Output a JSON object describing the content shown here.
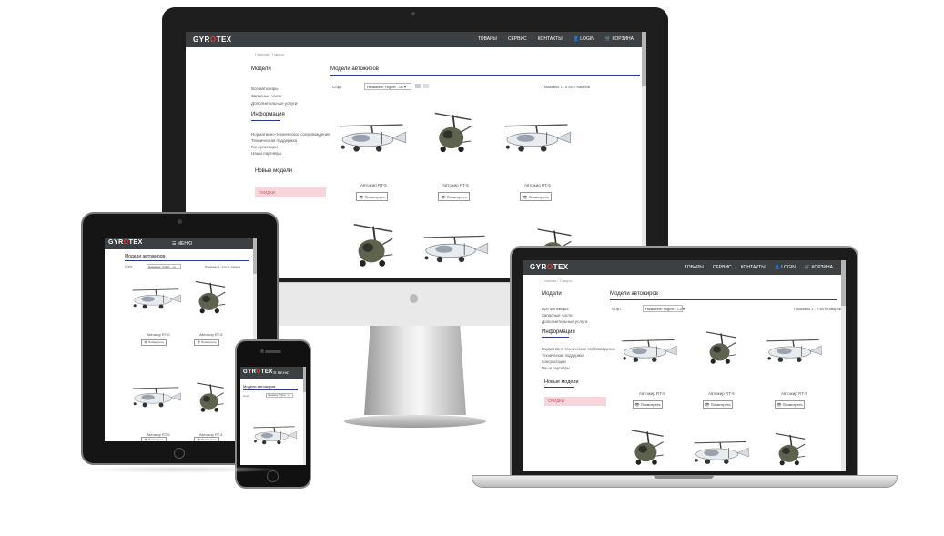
{
  "site": {
    "logo_a": "GYR",
    "logo_o": "O",
    "logo_b": "TEX",
    "nav": [
      "ТОВАРЫ",
      "СЕРВИС",
      "КОНТАКТЫ",
      "LOGIN",
      "КОРЗИНА"
    ],
    "breadcrumb": "Главная / Товары",
    "sidebar": {
      "models_title": "Модели",
      "models_items": [
        "Все автожиры",
        "Запасные части",
        "Дополнительные услуги"
      ],
      "info_title": "Информация",
      "info_items": [
        "Нормативно-техническое сопровождение",
        "Техническая поддержка",
        "Консультации",
        "Наши партнёры"
      ],
      "new_title": "Новые модели",
      "new_badge": "СКИДКИ"
    },
    "content_title": "Модели автожиров",
    "sort_label": "Сорт.",
    "sort_value": "Название: Higher - Lo",
    "count_text": "Показаны 1 - 6 из 6 товаров",
    "products": [
      {
        "name": "Автожир RT-5",
        "button": "Посмотреть"
      },
      {
        "name": "Автожир RT-5",
        "button": "Посмотреть"
      },
      {
        "name": "Автожир RT-5",
        "button": "Посмотреть"
      },
      {
        "name": "Автожир RT-5",
        "button": "Посмотреть"
      },
      {
        "name": "Автожир RT-5",
        "button": "Посмотреть"
      },
      {
        "name": "Автожир RT-5",
        "button": "Посмотреть"
      }
    ],
    "mobile_menu": "МЕНЮ"
  },
  "colors": {
    "nav_bg": "#3d4043",
    "accent_red": "#e23a3a",
    "underline": "#2a3a8c",
    "badge_bg": "#f8d5da"
  }
}
